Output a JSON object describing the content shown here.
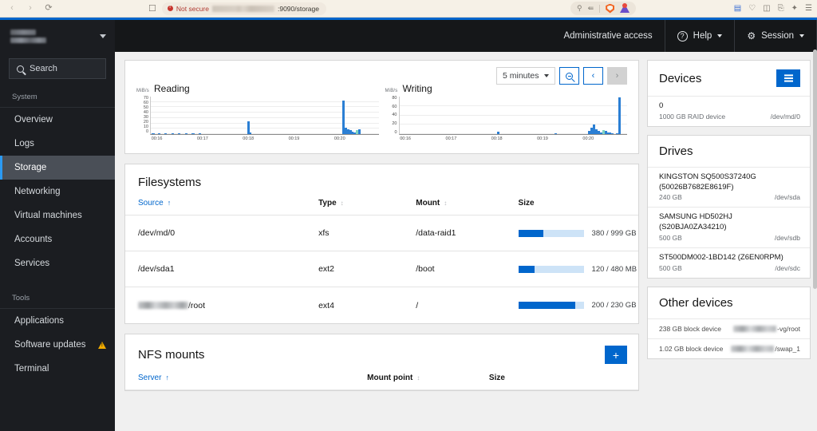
{
  "browser": {
    "back_icon": "‹",
    "forward_icon": "›",
    "reload_icon": "⟳",
    "bookmark_icon": "bookmark-icon",
    "security_label": "Not secure",
    "url_suffix": ":9090/storage",
    "toolbar_icons": [
      "zoom-icon",
      "share-icon",
      "shield-icon",
      "extension-icon"
    ],
    "right_icons": [
      "tab-sync-icon",
      "bell-icon",
      "sidebar-icon",
      "cast-icon",
      "collections-icon",
      "menu-icon"
    ]
  },
  "header": {
    "admin_access": "Administrative access",
    "help_label": "Help",
    "session_label": "Session"
  },
  "sidebar": {
    "search_placeholder": "Search",
    "groups": [
      {
        "label": "System",
        "items": [
          {
            "label": "Overview",
            "active": false,
            "warn": false
          },
          {
            "label": "Logs",
            "active": false,
            "warn": false
          },
          {
            "label": "Storage",
            "active": true,
            "warn": false
          },
          {
            "label": "Networking",
            "active": false,
            "warn": false
          },
          {
            "label": "Virtual machines",
            "active": false,
            "warn": false
          },
          {
            "label": "Accounts",
            "active": false,
            "warn": false
          },
          {
            "label": "Services",
            "active": false,
            "warn": false
          }
        ]
      },
      {
        "label": "Tools",
        "items": [
          {
            "label": "Applications",
            "active": false,
            "warn": false
          },
          {
            "label": "Software updates",
            "active": false,
            "warn": true
          },
          {
            "label": "Terminal",
            "active": false,
            "warn": false
          }
        ]
      }
    ]
  },
  "time_controls": {
    "range_value": "5 minutes",
    "zoom_out_icon": "zoom-out-icon",
    "prev_label": "‹",
    "next_label": "›"
  },
  "chart_data": [
    {
      "type": "bar",
      "title": "Reading",
      "ylabel": "MiB/s",
      "xlabel": "",
      "ylim": [
        0,
        70
      ],
      "yticks": [
        70,
        60,
        50,
        40,
        30,
        20,
        10,
        0
      ],
      "xticks": [
        "00:16",
        "00:17",
        "00:18",
        "00:19",
        "00:20"
      ],
      "grid": true,
      "x": [
        0.5,
        3,
        6,
        9,
        12,
        15,
        18,
        21,
        24,
        27,
        30,
        33,
        36,
        39,
        42.5,
        43,
        45,
        48,
        51,
        54,
        57,
        60,
        63,
        66,
        69,
        72,
        75,
        78,
        81,
        84,
        85,
        86,
        87,
        88,
        89,
        91,
        93
      ],
      "values": [
        1,
        1,
        1,
        1,
        1,
        1,
        1,
        1,
        0,
        0,
        0,
        0,
        0,
        0,
        24,
        3,
        0,
        0,
        0,
        0,
        0,
        0,
        0,
        0,
        0,
        0,
        0,
        0,
        0,
        63,
        12,
        9,
        7,
        5,
        3,
        9,
        0
      ],
      "secondary_color_points": [
        {
          "x": 90,
          "value": 8,
          "color": "#7fd4c1"
        }
      ],
      "series_color": "#2b7fd4"
    },
    {
      "type": "bar",
      "title": "Writing",
      "ylabel": "MiB/s",
      "xlabel": "",
      "ylim": [
        0,
        80
      ],
      "yticks": [
        80,
        60,
        40,
        20,
        0
      ],
      "xticks": [
        "00:16",
        "00:17",
        "00:18",
        "00:19",
        "00:20"
      ],
      "grid": true,
      "x": [
        1,
        5,
        10,
        15,
        20,
        25,
        30,
        35,
        40,
        43,
        45,
        50,
        55,
        60,
        65,
        68,
        70,
        75,
        80,
        83,
        84,
        85,
        86,
        87,
        88,
        90,
        91,
        92,
        93,
        95,
        96,
        97
      ],
      "values": [
        0.5,
        0.5,
        0.5,
        0.5,
        0.5,
        0.5,
        0.5,
        0.5,
        0.5,
        5,
        0.5,
        0.5,
        0.5,
        0.5,
        0.5,
        2,
        0.5,
        0.5,
        0.5,
        6,
        14,
        20,
        11,
        6,
        4,
        7,
        3,
        4,
        2,
        1,
        78,
        0.5
      ],
      "secondary_color_points": [
        {
          "x": 89,
          "value": 9,
          "color": "#7fd4c1"
        }
      ],
      "series_color": "#2b7fd4"
    }
  ],
  "filesystems": {
    "title": "Filesystems",
    "columns": [
      "Source",
      "Type",
      "Mount",
      "Size"
    ],
    "sort_column": "Source",
    "rows": [
      {
        "source": "/dev/md/0",
        "source_redacted": false,
        "type": "xfs",
        "mount": "/data-raid1",
        "pct": 38,
        "size": "380 / 999 GB"
      },
      {
        "source": "/dev/sda1",
        "source_redacted": false,
        "type": "ext2",
        "mount": "/boot",
        "pct": 25,
        "size": "120 / 480 MB"
      },
      {
        "source": "/root",
        "source_redacted": true,
        "type": "ext4",
        "mount": "/",
        "pct": 87,
        "size": "200 / 230 GB"
      }
    ]
  },
  "nfs_mounts": {
    "title": "NFS mounts",
    "add_label": "+",
    "columns": [
      "Server",
      "Mount point",
      "Size"
    ],
    "sort_column": "Server",
    "rows": []
  },
  "devices": {
    "title": "Devices",
    "menu_icon": "hamburger-icon",
    "rows": [
      {
        "name": "0",
        "sub": "1000 GB RAID device",
        "dev": "/dev/md/0"
      }
    ]
  },
  "drives": {
    "title": "Drives",
    "rows": [
      {
        "name": "KINGSTON SQ500S37240G (50026B7682E8619F)",
        "sub": "240 GB",
        "dev": "/dev/sda"
      },
      {
        "name": "SAMSUNG HD502HJ (S20BJA0ZA34210)",
        "sub": "500 GB",
        "dev": "/dev/sdb"
      },
      {
        "name": "ST500DM002-1BD142 (Z6EN0RPM)",
        "sub": "500 GB",
        "dev": "/dev/sdc"
      }
    ]
  },
  "other_devices": {
    "title": "Other devices",
    "rows": [
      {
        "label": "238 GB block device",
        "value": "-vg/root",
        "value_redacted": true
      },
      {
        "label": "1.02 GB block device",
        "value": "/swap_1",
        "value_redacted": true
      }
    ]
  },
  "colors": {
    "accent_blue": "#0066cc",
    "chart_blue": "#2b7fd4",
    "chart_teal": "#7fd4c1",
    "sidebar_bg": "#1b1d21",
    "topbar_bg": "#151719",
    "warn_yellow": "#f0ab00",
    "insecure_red": "#c8362f"
  }
}
